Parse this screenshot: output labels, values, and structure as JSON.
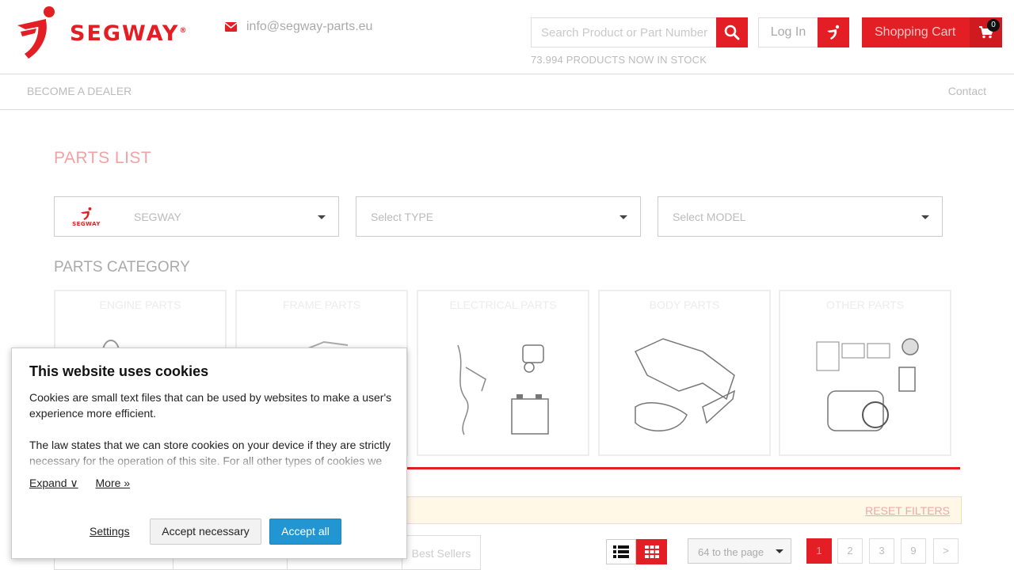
{
  "header": {
    "brand": "SEGWAY",
    "email": "info@segway-parts.eu",
    "search_placeholder": "Search Product or Part Number",
    "stock_text": "73.994 PRODUCTS NOW IN STOCK",
    "login_label": "Log In",
    "cart_label": "Shopping Cart",
    "cart_count": "0",
    "brand_color": "#e31e24"
  },
  "nav": {
    "become_dealer": "BECOME A DEALER",
    "contact": "Contact"
  },
  "main": {
    "title": "PARTS LIST",
    "selects": {
      "brand": "SEGWAY",
      "brand_logo_text": "SEGWAY",
      "type": "Select TYPE",
      "model": "Select MODEL"
    },
    "category_title": "PARTS CATEGORY",
    "categories": [
      "ENGINE PARTS",
      "FRAME PARTS",
      "ELECTRICAL PARTS",
      "BODY PARTS",
      "OTHER PARTS"
    ],
    "reset_filters": "RESET FILTERS",
    "sort_tabs": [
      "",
      "",
      "",
      "Best Sellers"
    ],
    "per_page": "64 to the page",
    "pagination": [
      "1",
      "2",
      "3",
      "9",
      ">"
    ]
  },
  "cookie": {
    "title": "This website uses cookies",
    "p1": "Cookies are small text files that can be used by websites to make a user's experience more efficient.",
    "p2": "The law states that we can store cookies on your device if they are strictly necessary for the operation of this site. For all other types of cookies we",
    "expand": "Expand ∨",
    "more": "More »",
    "settings": "Settings",
    "accept_necessary": "Accept necessary",
    "accept_all": "Accept all",
    "button_color": "#2196d3"
  }
}
